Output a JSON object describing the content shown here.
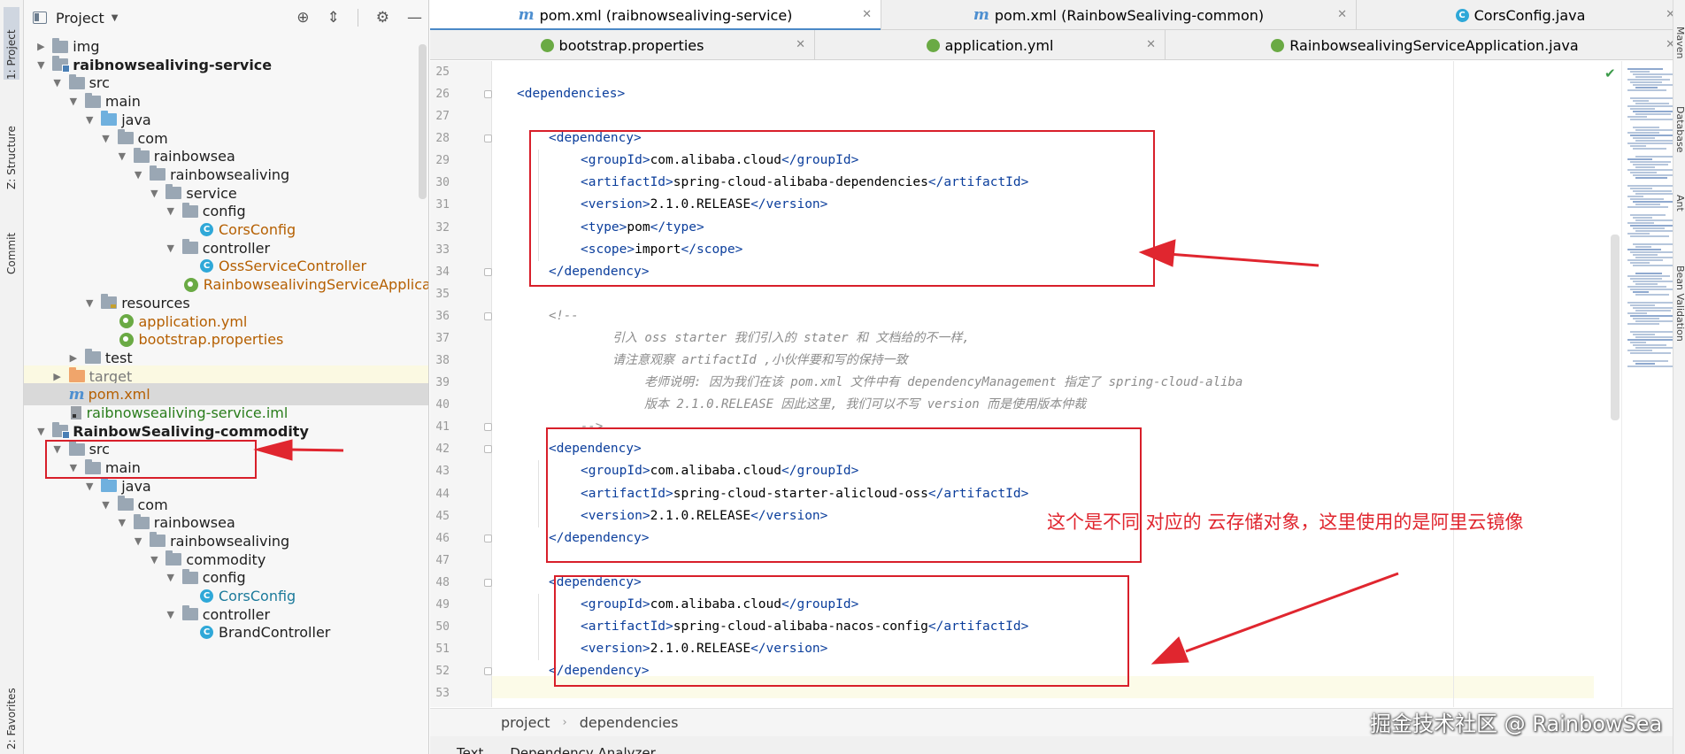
{
  "tool_strip": {
    "project_tab": "1: Project",
    "structure_tab": "Z: Structure",
    "commit_tab": "Commit",
    "favorites_tab": "2: Favorites"
  },
  "project_panel": {
    "title": "Project",
    "tree": [
      {
        "label": "img",
        "depth": 1,
        "arrow": "right",
        "icon": "folder",
        "color": "dark"
      },
      {
        "label": "raibnowsealiving-service",
        "depth": 1,
        "arrow": "down",
        "icon": "module",
        "color": "dark",
        "bold": true
      },
      {
        "label": "src",
        "depth": 2,
        "arrow": "down",
        "icon": "folder",
        "color": "dark"
      },
      {
        "label": "main",
        "depth": 3,
        "arrow": "down",
        "icon": "folder",
        "color": "dark"
      },
      {
        "label": "java",
        "depth": 4,
        "arrow": "down",
        "icon": "folder-blue",
        "color": "dark"
      },
      {
        "label": "com",
        "depth": 5,
        "arrow": "down",
        "icon": "folder",
        "color": "dark"
      },
      {
        "label": "rainbowsea",
        "depth": 6,
        "arrow": "down",
        "icon": "folder",
        "color": "dark"
      },
      {
        "label": "rainbowsealiving",
        "depth": 7,
        "arrow": "down",
        "icon": "folder",
        "color": "dark"
      },
      {
        "label": "service",
        "depth": 8,
        "arrow": "down",
        "icon": "folder",
        "color": "dark"
      },
      {
        "label": "config",
        "depth": 9,
        "arrow": "down",
        "icon": "folder",
        "color": "dark"
      },
      {
        "label": "CorsConfig",
        "depth": 10,
        "arrow": "",
        "icon": "class",
        "color": "orange"
      },
      {
        "label": "controller",
        "depth": 9,
        "arrow": "down",
        "icon": "folder",
        "color": "dark"
      },
      {
        "label": "OssServiceController",
        "depth": 10,
        "arrow": "",
        "icon": "class",
        "color": "orange"
      },
      {
        "label": "RainbowsealivingServiceApplication",
        "depth": 9,
        "arrow": "",
        "icon": "spring",
        "color": "orange"
      },
      {
        "label": "resources",
        "depth": 4,
        "arrow": "down",
        "icon": "folder-res",
        "color": "dark"
      },
      {
        "label": "application.yml",
        "depth": 5,
        "arrow": "",
        "icon": "spring",
        "color": "orange"
      },
      {
        "label": "bootstrap.properties",
        "depth": 5,
        "arrow": "",
        "icon": "spring",
        "color": "orange"
      },
      {
        "label": "test",
        "depth": 3,
        "arrow": "right",
        "icon": "folder",
        "color": "dark"
      },
      {
        "label": "target",
        "depth": 2,
        "arrow": "right",
        "icon": "folder-orange",
        "color": "grey",
        "highlight": "target"
      },
      {
        "label": "pom.xml",
        "depth": 2,
        "arrow": "",
        "icon": "maven",
        "color": "orange",
        "highlight": "selected"
      },
      {
        "label": "raibnowsealiving-service.iml",
        "depth": 2,
        "arrow": "",
        "icon": "iml",
        "color": "green"
      },
      {
        "label": "RainbowSealiving-commodity",
        "depth": 1,
        "arrow": "down",
        "icon": "module",
        "color": "dark",
        "bold": true
      },
      {
        "label": "src",
        "depth": 2,
        "arrow": "down",
        "icon": "folder",
        "color": "dark"
      },
      {
        "label": "main",
        "depth": 3,
        "arrow": "down",
        "icon": "folder",
        "color": "dark"
      },
      {
        "label": "java",
        "depth": 4,
        "arrow": "down",
        "icon": "folder-blue",
        "color": "dark"
      },
      {
        "label": "com",
        "depth": 5,
        "arrow": "down",
        "icon": "folder",
        "color": "dark"
      },
      {
        "label": "rainbowsea",
        "depth": 6,
        "arrow": "down",
        "icon": "folder",
        "color": "dark"
      },
      {
        "label": "rainbowsealiving",
        "depth": 7,
        "arrow": "down",
        "icon": "folder",
        "color": "dark"
      },
      {
        "label": "commodity",
        "depth": 8,
        "arrow": "down",
        "icon": "folder",
        "color": "dark"
      },
      {
        "label": "config",
        "depth": 9,
        "arrow": "down",
        "icon": "folder",
        "color": "dark"
      },
      {
        "label": "CorsConfig",
        "depth": 10,
        "arrow": "",
        "icon": "class",
        "color": "teal"
      },
      {
        "label": "controller",
        "depth": 9,
        "arrow": "down",
        "icon": "folder",
        "color": "dark"
      },
      {
        "label": "BrandController",
        "depth": 10,
        "arrow": "",
        "icon": "class",
        "color": "dark"
      }
    ]
  },
  "editor_tabs_row1": [
    {
      "label": "pom.xml (raibnowsealiving-service)",
      "icon": "maven",
      "active": true
    },
    {
      "label": "pom.xml (RainbowSealiving-common)",
      "icon": "maven",
      "active": false
    },
    {
      "label": "CorsConfig.java",
      "icon": "class",
      "active": false
    }
  ],
  "editor_tabs_row2": [
    {
      "label": "bootstrap.properties",
      "icon": "spring",
      "active": false
    },
    {
      "label": "application.yml",
      "icon": "spring",
      "active": false
    },
    {
      "label": "RainbowsealivingServiceApplication.java",
      "icon": "spring",
      "active": false
    }
  ],
  "code": {
    "line_numbers": [
      "25",
      "26",
      "27",
      "28",
      "29",
      "30",
      "31",
      "32",
      "33",
      "34",
      "35",
      "36",
      "37",
      "38",
      "39",
      "40",
      "41",
      "42",
      "43",
      "44",
      "45",
      "46",
      "47",
      "48",
      "49",
      "50",
      "51",
      "52",
      "53"
    ],
    "lines": [
      {
        "indent": 0,
        "text": ""
      },
      {
        "indent": 1,
        "tag_open": "<dependencies>"
      },
      {
        "indent": 0,
        "text": ""
      },
      {
        "indent": 2,
        "tag_open": "<dependency>"
      },
      {
        "indent": 3,
        "tag": "groupId",
        "value": "com.alibaba.cloud"
      },
      {
        "indent": 3,
        "tag": "artifactId",
        "value": "spring-cloud-alibaba-dependencies"
      },
      {
        "indent": 3,
        "tag": "version",
        "value": "2.1.0.RELEASE"
      },
      {
        "indent": 3,
        "tag": "type",
        "value": "pom"
      },
      {
        "indent": 3,
        "tag": "scope",
        "value": "import"
      },
      {
        "indent": 2,
        "tag_open": "</dependency>"
      },
      {
        "indent": 0,
        "text": ""
      },
      {
        "indent": 2,
        "comment": "<!--"
      },
      {
        "indent": 4,
        "comment": "引入 oss starter 我们引入的 stater 和 文档给的不一样,"
      },
      {
        "indent": 4,
        "comment": "请注意观察 artifactId ,小伙伴要和写的保持一致"
      },
      {
        "indent": 5,
        "comment": "老师说明: 因为我们在该 pom.xml 文件中有 dependencyManagement 指定了 spring-cloud-aliba"
      },
      {
        "indent": 5,
        "comment": "版本 2.1.0.RELEASE 因此这里, 我们可以不写 version 而是使用版本仲裁"
      },
      {
        "indent": 3,
        "comment": "-->"
      },
      {
        "indent": 2,
        "tag_open": "<dependency>"
      },
      {
        "indent": 3,
        "tag": "groupId",
        "value": "com.alibaba.cloud"
      },
      {
        "indent": 3,
        "tag": "artifactId",
        "value": "spring-cloud-starter-alicloud-oss"
      },
      {
        "indent": 3,
        "tag": "version",
        "value": "2.1.0.RELEASE"
      },
      {
        "indent": 2,
        "tag_open": "</dependency>"
      },
      {
        "indent": 0,
        "text": ""
      },
      {
        "indent": 2,
        "tag_open": "<dependency>"
      },
      {
        "indent": 3,
        "tag": "groupId",
        "value": "com.alibaba.cloud"
      },
      {
        "indent": 3,
        "tag": "artifactId",
        "value": "spring-cloud-alibaba-nacos-config"
      },
      {
        "indent": 3,
        "tag": "version",
        "value": "2.1.0.RELEASE"
      },
      {
        "indent": 2,
        "tag_open": "</dependency>"
      },
      {
        "indent": 0,
        "text": ""
      }
    ]
  },
  "breadcrumb": [
    "project",
    "dependencies"
  ],
  "bottom_tabs": [
    "Text",
    "Dependency Analyzer"
  ],
  "annotation": {
    "text": "这个是不同 对应的 云存储对象，这里使用的是阿里云镜像",
    "color": "#e0262f"
  },
  "watermark": "掘金技术社区 @ RainbowSea",
  "colors": {
    "xml_tag": "#0b3e9c",
    "comment": "#8c8c8c",
    "annotation_red": "#d81f2a"
  }
}
